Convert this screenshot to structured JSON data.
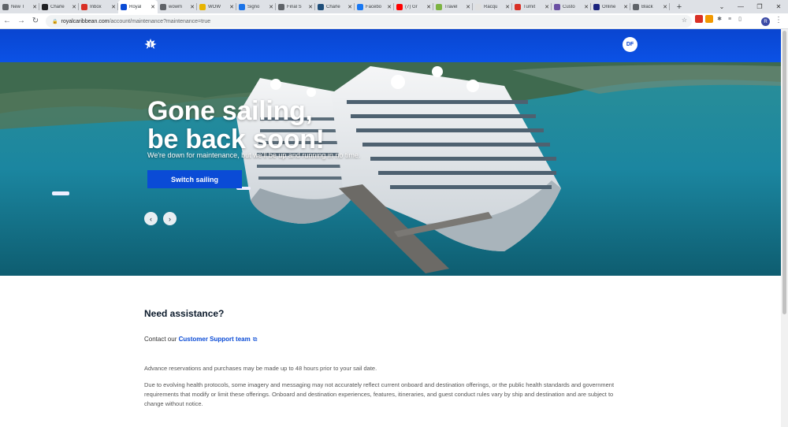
{
  "browser": {
    "tabs": [
      {
        "label": "New T",
        "color": "#5f6368"
      },
      {
        "label": "Charle",
        "color": "#202124"
      },
      {
        "label": "Inbox",
        "color": "#d93025"
      },
      {
        "label": "Royal",
        "color": "#0a4bd6",
        "active": true
      },
      {
        "label": "wowm",
        "color": "#5f6368"
      },
      {
        "label": "WOW",
        "color": "#e8b400"
      },
      {
        "label": "Signo",
        "color": "#1a73e8"
      },
      {
        "label": "Final S",
        "color": "#5f6368"
      },
      {
        "label": "Charle",
        "color": "#1f4e79"
      },
      {
        "label": "Facebo",
        "color": "#1877f2"
      },
      {
        "label": "(7) Gr",
        "color": "#ff0000"
      },
      {
        "label": "Travel",
        "color": "#7cb342"
      },
      {
        "label": "Racqu",
        "color": "#e0e0e0"
      },
      {
        "label": "Turnit",
        "color": "#d93025"
      },
      {
        "label": "Custo",
        "color": "#6a4fa3"
      },
      {
        "label": "Online",
        "color": "#1a237e"
      },
      {
        "label": "Black",
        "color": "#5f6368"
      }
    ],
    "url_domain": "royalcaribbean.com",
    "url_path": "/account/maintenance?maintenance=true",
    "profile_initial": "R"
  },
  "header": {
    "avatar_initials": "DF"
  },
  "hero": {
    "title_line1": "Gone sailing,",
    "title_line2": "be back soon!",
    "subtitle": "We're down for maintenance, but we'll be up and running in no time.",
    "button_label": "Switch sailing"
  },
  "assistance": {
    "title": "Need assistance?",
    "contact_prefix": "Contact our",
    "contact_link": "Customer Support team",
    "advance_note": "Advance reservations and purchases may be made up to 48 hours prior to your sail date.",
    "disclaimer": "Due to evolving health protocols, some imagery and messaging may not accurately reflect current onboard and destination offerings, or the public health standards and government requirements that modify or limit these offerings. Onboard and destination experiences, features, itineraries, and guest conduct rules vary by ship and destination and are subject to change without notice."
  },
  "colors": {
    "brand_blue": "#0a4bd6"
  }
}
